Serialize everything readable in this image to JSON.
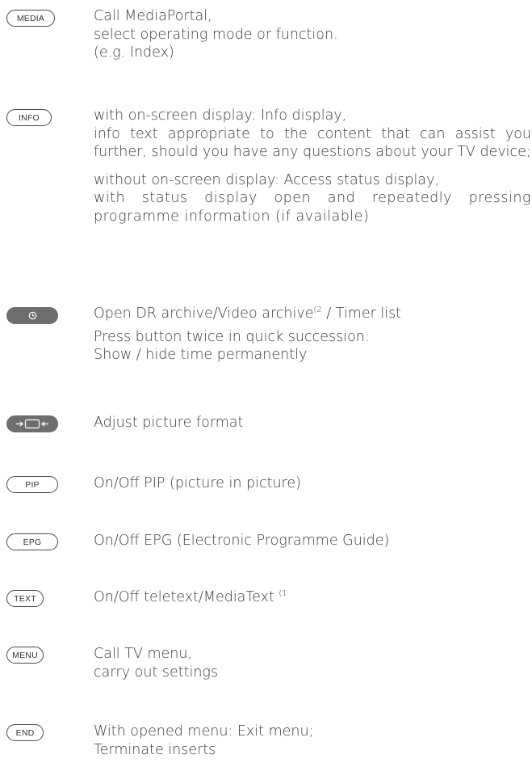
{
  "entries": [
    {
      "button": "MEDIA",
      "lines": [
        "Call MediaPortal,",
        "select operating mode or function.",
        "(e.g. Index)"
      ]
    },
    {
      "button": "INFO",
      "line1": "with on-screen display: Info display,",
      "para1": "info text appropriate to the content that can assist you further, should you have any questions about your TV device;",
      "line2": "without on-screen display: Access status display,",
      "para2": "with status display open and repeatedly pressing programme information (if available)"
    },
    {
      "button_icon": "clock-icon",
      "line1_a": "Open DR archive/Video archive",
      "line1_sup": "(2",
      "line1_b": " / Timer list",
      "line2": "Press button twice in quick succession:",
      "line3": "Show / hide time permanently"
    },
    {
      "button_icon": "picture-format-icon",
      "text": "Adjust picture format"
    },
    {
      "button": "PIP",
      "text": "On/Off PIP (picture in picture)"
    },
    {
      "button": "EPG",
      "text": "On/Off EPG (Electronic Programme Guide)"
    },
    {
      "button": "TEXT",
      "text": "On/Off teletext/MediaText",
      "sup": "(1"
    },
    {
      "button": "MENU",
      "lines": [
        "Call TV menu,",
        "carry out settings"
      ]
    },
    {
      "button": "END",
      "lines": [
        "With opened menu: Exit menu;",
        "Terminate inserts"
      ]
    }
  ]
}
